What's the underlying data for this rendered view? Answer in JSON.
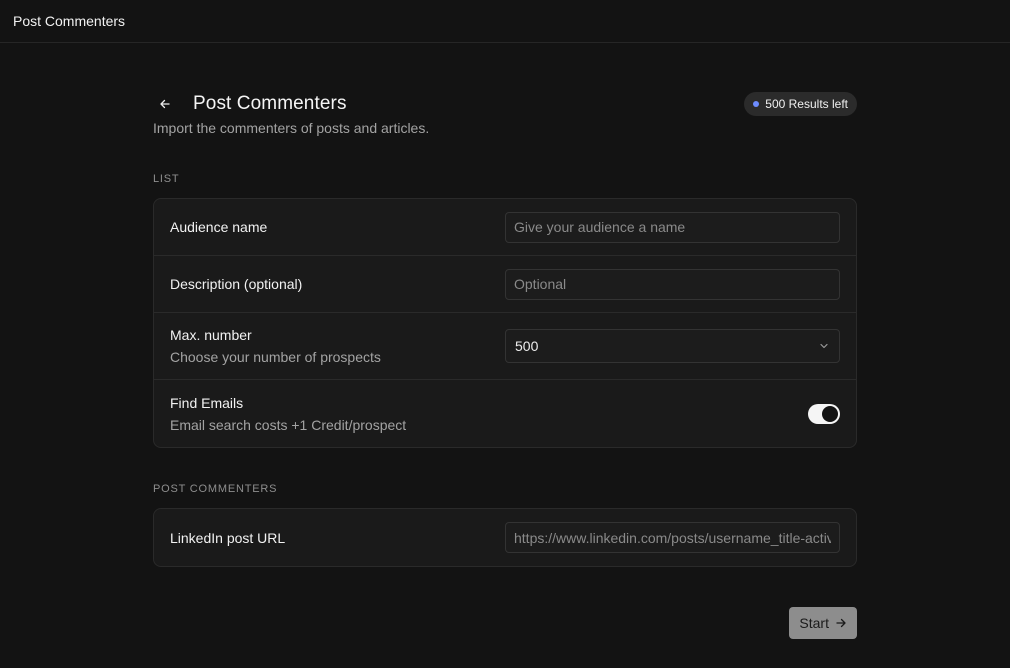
{
  "topbar": {
    "title": "Post Commenters"
  },
  "header": {
    "title": "Post Commenters",
    "subtitle": "Import the commenters of posts and articles.",
    "badge": "500 Results left"
  },
  "sections": {
    "list_label": "LIST",
    "post_label": "POST COMMENTERS"
  },
  "list": {
    "audience_name": {
      "label": "Audience name",
      "placeholder": "Give your audience a name"
    },
    "description": {
      "label": "Description (optional)",
      "placeholder": "Optional"
    },
    "max_number": {
      "label": "Max. number",
      "sublabel": "Choose your number of prospects",
      "value": "500"
    },
    "find_emails": {
      "label": "Find Emails",
      "sublabel": "Email search costs +1 Credit/prospect",
      "enabled": true
    }
  },
  "post": {
    "url": {
      "label": "LinkedIn post URL",
      "placeholder": "https://www.linkedin.com/posts/username_title-activity"
    }
  },
  "footer": {
    "start_label": "Start"
  },
  "colors": {
    "accent_dot": "#6d8cff",
    "background": "#131313",
    "card": "#1a1a1a"
  }
}
